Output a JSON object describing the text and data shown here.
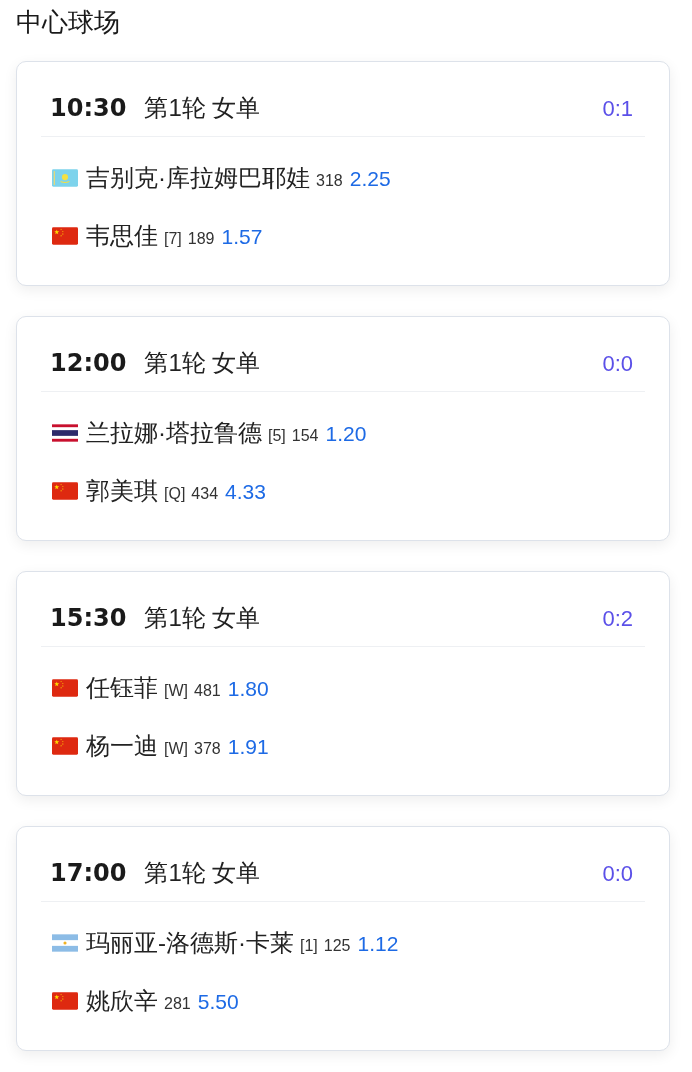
{
  "court": {
    "title": "中心球场"
  },
  "matches": [
    {
      "time": "10:30",
      "round": "第1轮 女单",
      "score": "0:1",
      "players": [
        {
          "kind": "kazakhstan",
          "name": "吉别克·库拉姆巴耶娃",
          "rank": "318",
          "odds": "2.25"
        },
        {
          "kind": "china",
          "name": "韦思佳",
          "seed": "[7]",
          "rank": "189",
          "odds": "1.57"
        }
      ]
    },
    {
      "time": "12:00",
      "round": "第1轮 女单",
      "score": "0:0",
      "players": [
        {
          "kind": "thailand",
          "name": "兰拉娜·塔拉鲁德",
          "seed": "[5]",
          "rank": "154",
          "odds": "1.20"
        },
        {
          "kind": "china",
          "name": "郭美琪",
          "seed": "[Q]",
          "rank": "434",
          "odds": "4.33"
        }
      ]
    },
    {
      "time": "15:30",
      "round": "第1轮 女单",
      "score": "0:2",
      "players": [
        {
          "kind": "china",
          "name": "任钰菲",
          "seed": "[W]",
          "rank": "481",
          "odds": "1.80"
        },
        {
          "kind": "china",
          "name": "杨一迪",
          "seed": "[W]",
          "rank": "378",
          "odds": "1.91"
        }
      ]
    },
    {
      "time": "17:00",
      "round": "第1轮 女单",
      "score": "0:0",
      "players": [
        {
          "kind": "argentina",
          "name": "玛丽亚-洛德斯·卡莱",
          "seed": "[1]",
          "rank": "125",
          "odds": "1.12"
        },
        {
          "kind": "china",
          "name": "姚欣辛",
          "rank": "281",
          "odds": "5.50"
        }
      ]
    }
  ]
}
